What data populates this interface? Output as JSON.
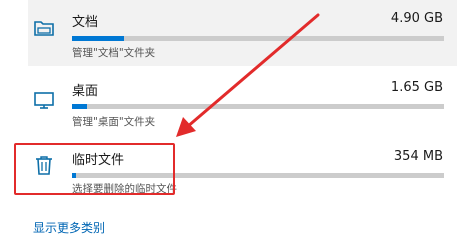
{
  "storage_items": [
    {
      "name": "文档",
      "size": "4.90 GB",
      "description": "管理\"文档\"文件夹",
      "usage_fraction": 0.08,
      "icon": "folder-icon"
    },
    {
      "name": "桌面",
      "size": "1.65 GB",
      "description": "管理\"桌面\"文件夹",
      "usage_fraction": 0.03,
      "icon": "monitor-icon"
    },
    {
      "name": "临时文件",
      "size": "354 MB",
      "description": "选择要删除的临时文件",
      "usage_fraction": 0.01,
      "icon": "trash-icon"
    }
  ],
  "show_more_label": "显示更多类别",
  "colors": {
    "accent": "#0078d4",
    "bar_track": "#cccccc",
    "annotation": "#e22b2b",
    "link": "#0066b4"
  }
}
